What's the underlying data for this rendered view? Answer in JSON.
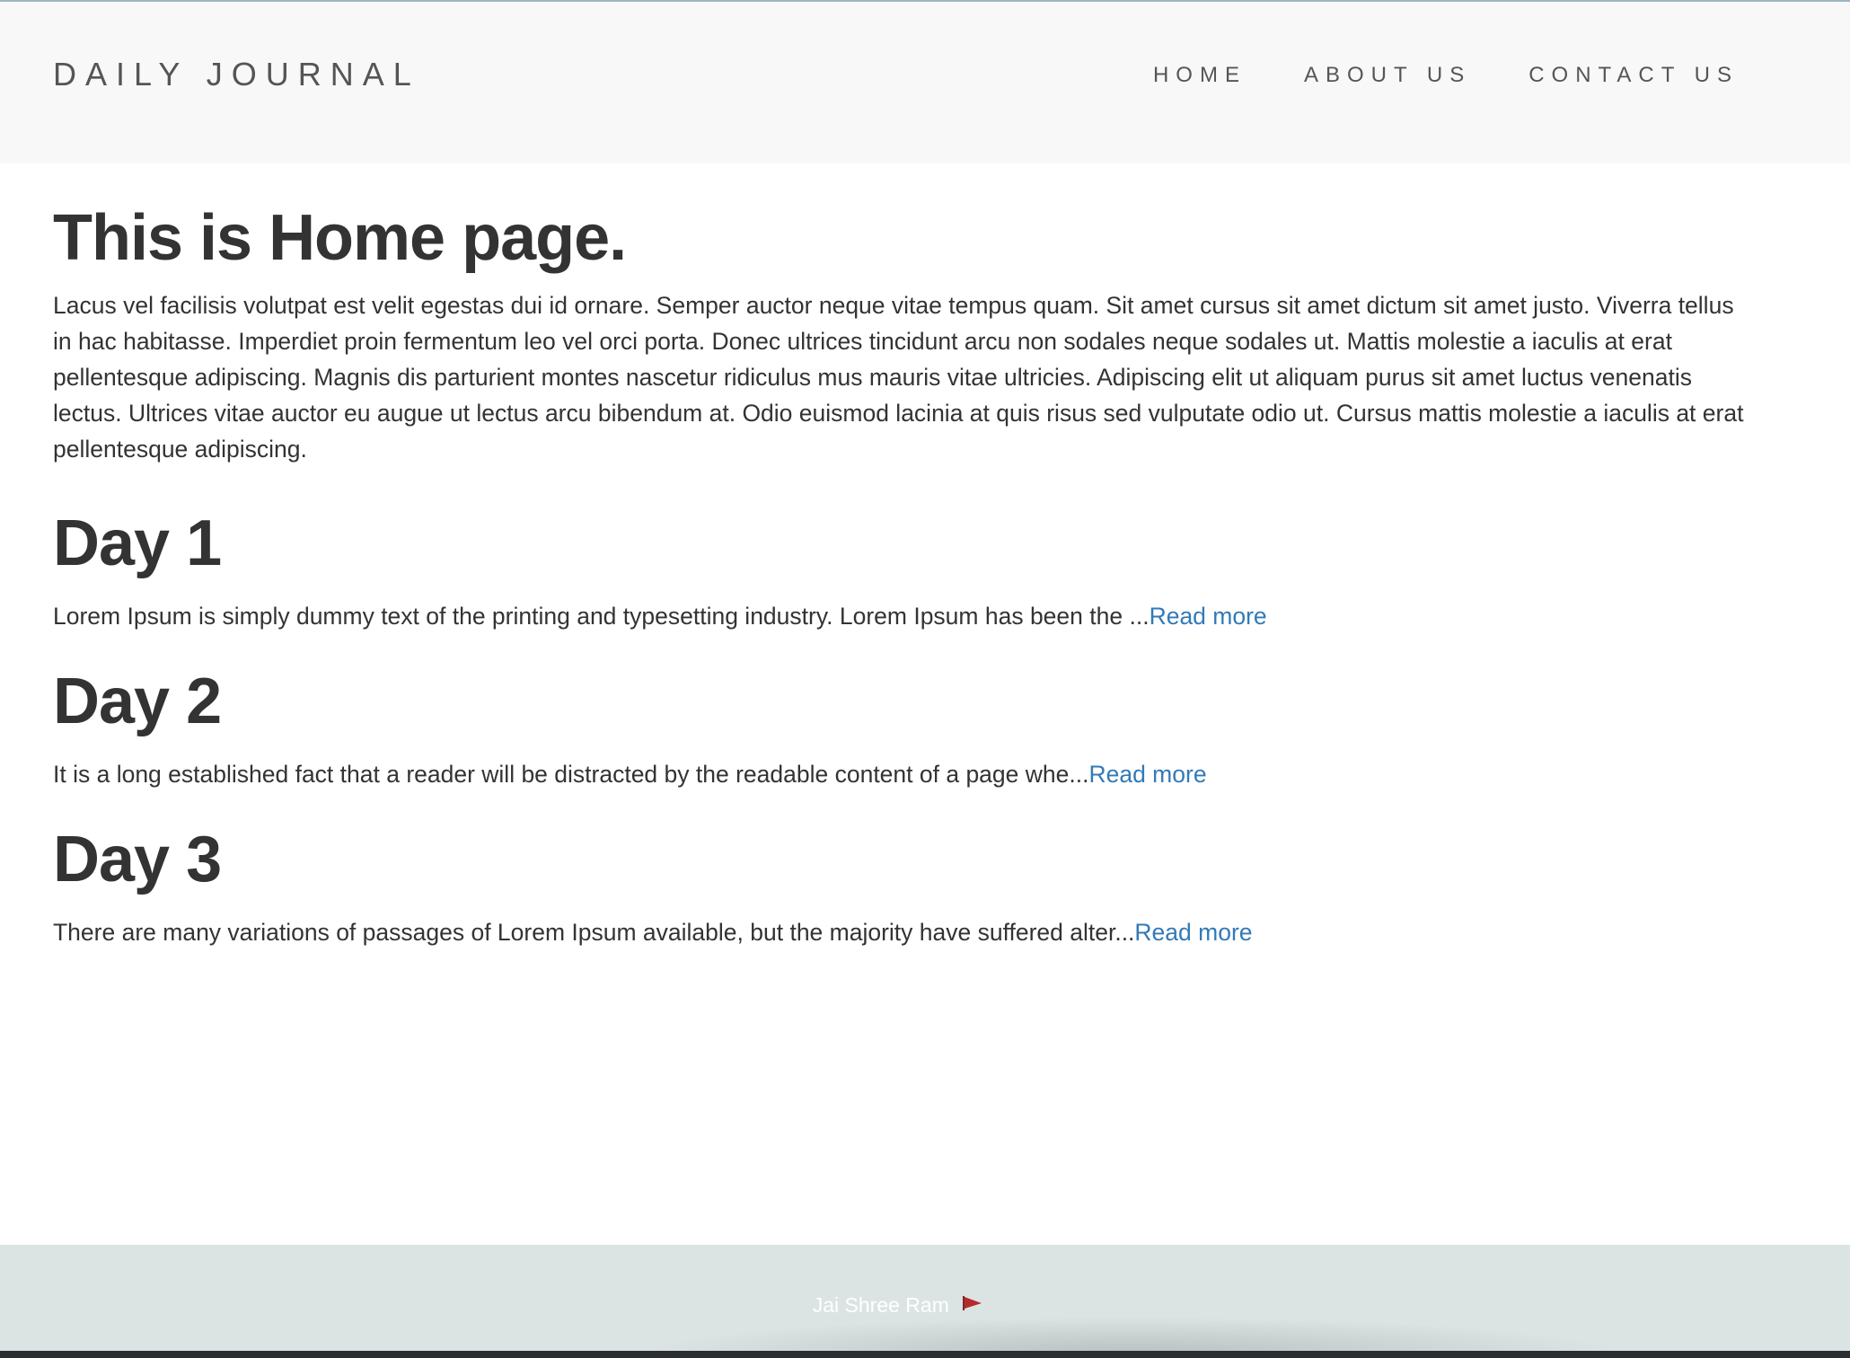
{
  "header": {
    "brand": "DAILY JOURNAL",
    "nav": [
      "HOME",
      "ABOUT US",
      "CONTACT US"
    ]
  },
  "main": {
    "title": "This is Home page.",
    "intro": "Lacus vel facilisis volutpat est velit egestas dui id ornare. Semper auctor neque vitae tempus quam. Sit amet cursus sit amet dictum sit amet justo. Viverra tellus in hac habitasse. Imperdiet proin fermentum leo vel orci porta. Donec ultrices tincidunt arcu non sodales neque sodales ut. Mattis molestie a iaculis at erat pellentesque adipiscing. Magnis dis parturient montes nascetur ridiculus mus mauris vitae ultricies. Adipiscing elit ut aliquam purus sit amet luctus venenatis lectus. Ultrices vitae auctor eu augue ut lectus arcu bibendum at. Odio euismod lacinia at quis risus sed vulputate odio ut. Cursus mattis molestie a iaculis at erat pellentesque adipiscing.",
    "posts": [
      {
        "title": "Day 1",
        "excerpt": "Lorem Ipsum is simply dummy text of the printing and typesetting industry. Lorem Ipsum has been the ...",
        "link": "Read more"
      },
      {
        "title": "Day 2",
        "excerpt": "It is a long established fact that a reader will be distracted by the readable content of a page whe...",
        "link": "Read more"
      },
      {
        "title": "Day 3",
        "excerpt": "There are many variations of passages of Lorem Ipsum available, but the majority have suffered alter...",
        "link": "Read more"
      }
    ]
  },
  "footer": {
    "text": "Jai Shree Ram",
    "icon": "flag-icon"
  },
  "colors": {
    "navbar_bg": "#f8f8f8",
    "link": "#337ab7",
    "text": "#333333",
    "footer_bg": "#dce3e3",
    "flag": "#b52a2a"
  }
}
